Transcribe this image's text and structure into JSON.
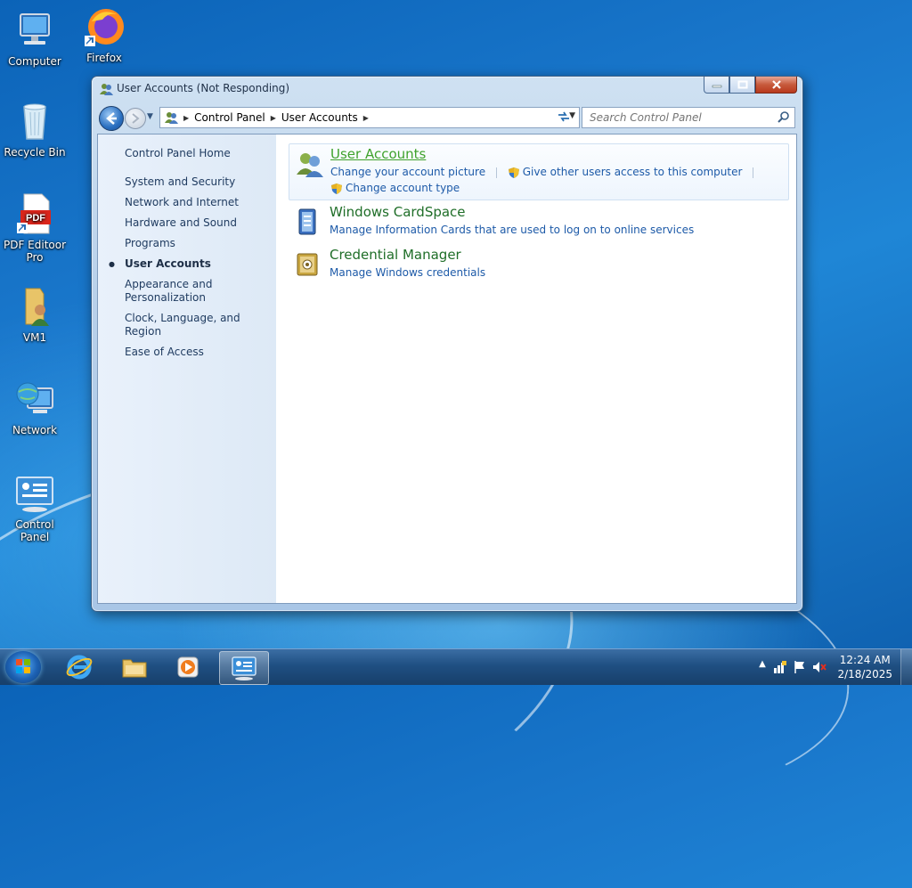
{
  "desktop": {
    "icons": [
      {
        "label": "Computer"
      },
      {
        "label": "Firefox"
      },
      {
        "label": "Recycle Bin"
      },
      {
        "label": "PDF Editoor Pro"
      },
      {
        "label": "VM1"
      },
      {
        "label": "Network"
      },
      {
        "label": "Control Panel"
      }
    ]
  },
  "window": {
    "title": "User Accounts (Not Responding)",
    "breadcrumb": [
      "Control Panel",
      "User Accounts"
    ],
    "search_placeholder": "Search Control Panel"
  },
  "sidebar": {
    "home": "Control Panel Home",
    "items": [
      {
        "label": "System and Security"
      },
      {
        "label": "Network and Internet"
      },
      {
        "label": "Hardware and Sound"
      },
      {
        "label": "Programs"
      },
      {
        "label": "User Accounts"
      },
      {
        "label": "Appearance and Personalization"
      },
      {
        "label": "Clock, Language, and Region"
      },
      {
        "label": "Ease of Access"
      }
    ]
  },
  "categories": [
    {
      "title": "User Accounts",
      "links": [
        "Change your account picture",
        "Give other users access to this computer",
        "Change account type"
      ]
    },
    {
      "title": "Windows CardSpace",
      "links": [
        "Manage Information Cards that are used to log on to online services"
      ]
    },
    {
      "title": "Credential Manager",
      "links": [
        "Manage Windows credentials"
      ]
    }
  ],
  "taskbar": {
    "clock_time": "12:24 AM",
    "clock_date": "2/18/2025"
  },
  "colors": {
    "link": "#1d5aa8",
    "category_title": "#1f6e28",
    "taskbar": "#1f4f82"
  }
}
